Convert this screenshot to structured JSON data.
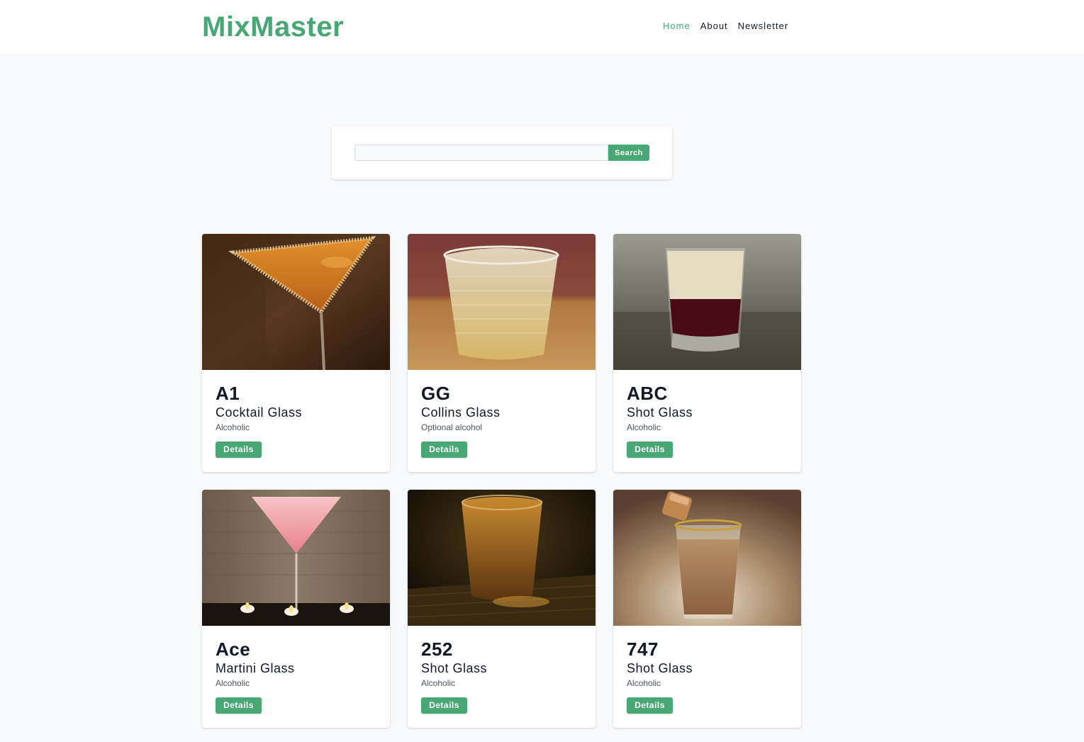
{
  "brand": {
    "name": "MixMaster",
    "color": "#47a876"
  },
  "nav": {
    "items": [
      {
        "label": "Home",
        "active": true
      },
      {
        "label": "About",
        "active": false
      },
      {
        "label": "Newsletter",
        "active": false
      }
    ]
  },
  "search": {
    "value": "",
    "placeholder": "",
    "button_label": "Search"
  },
  "cocktails": [
    {
      "name": "A1",
      "glass": "Cocktail Glass",
      "info": "Alcoholic",
      "button_label": "Details",
      "image": "orange cocktail in martini glass with sugared rim"
    },
    {
      "name": "GG",
      "glass": "Collins Glass",
      "info": "Optional alcohol",
      "button_label": "Details",
      "image": "clear drink with ice in textured glass"
    },
    {
      "name": "ABC",
      "glass": "Shot Glass",
      "info": "Alcoholic",
      "button_label": "Details",
      "image": "layered cream and dark red shot"
    },
    {
      "name": "Ace",
      "glass": "Martini Glass",
      "info": "Alcoholic",
      "button_label": "Details",
      "image": "pink cocktail in martini glass with candles"
    },
    {
      "name": "252",
      "glass": "Shot Glass",
      "info": "Alcoholic",
      "button_label": "Details",
      "image": "amber whiskey shot on wooden table"
    },
    {
      "name": "747",
      "glass": "Shot Glass",
      "info": "Alcoholic",
      "button_label": "Details",
      "image": "creamy shot with caramel topping"
    }
  ]
}
